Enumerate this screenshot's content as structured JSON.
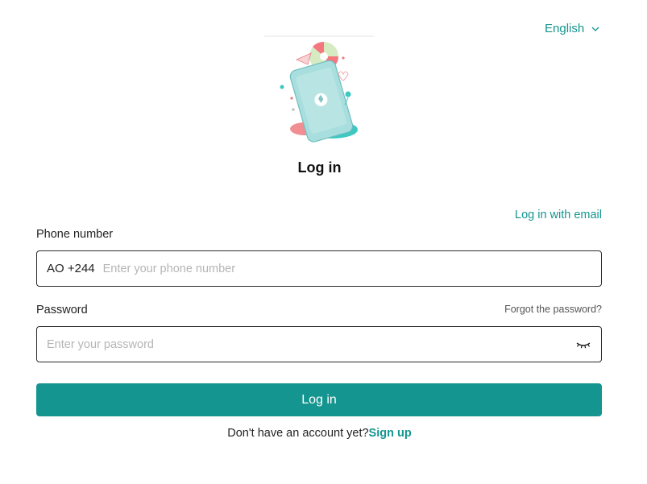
{
  "header": {
    "language": "English"
  },
  "login": {
    "title": "Log in",
    "alt_method_link": "Log in with email",
    "phone": {
      "label": "Phone number",
      "country_prefix": "AO +244",
      "placeholder": "Enter your phone number",
      "value": ""
    },
    "password": {
      "label": "Password",
      "forgot_link": "Forgot the password?",
      "placeholder": "Enter your password",
      "value": ""
    },
    "submit_label": "Log in",
    "signup_prompt": "Don't have an account yet?",
    "signup_link": "Sign up"
  },
  "colors": {
    "accent": "#14958f",
    "border": "#2a2a2a",
    "placeholder": "#b5b5b5"
  },
  "icons": {
    "language_toggle": "chevron-down-icon",
    "password_visibility": "eye-closed-icon",
    "hero": "phone-illustration"
  }
}
